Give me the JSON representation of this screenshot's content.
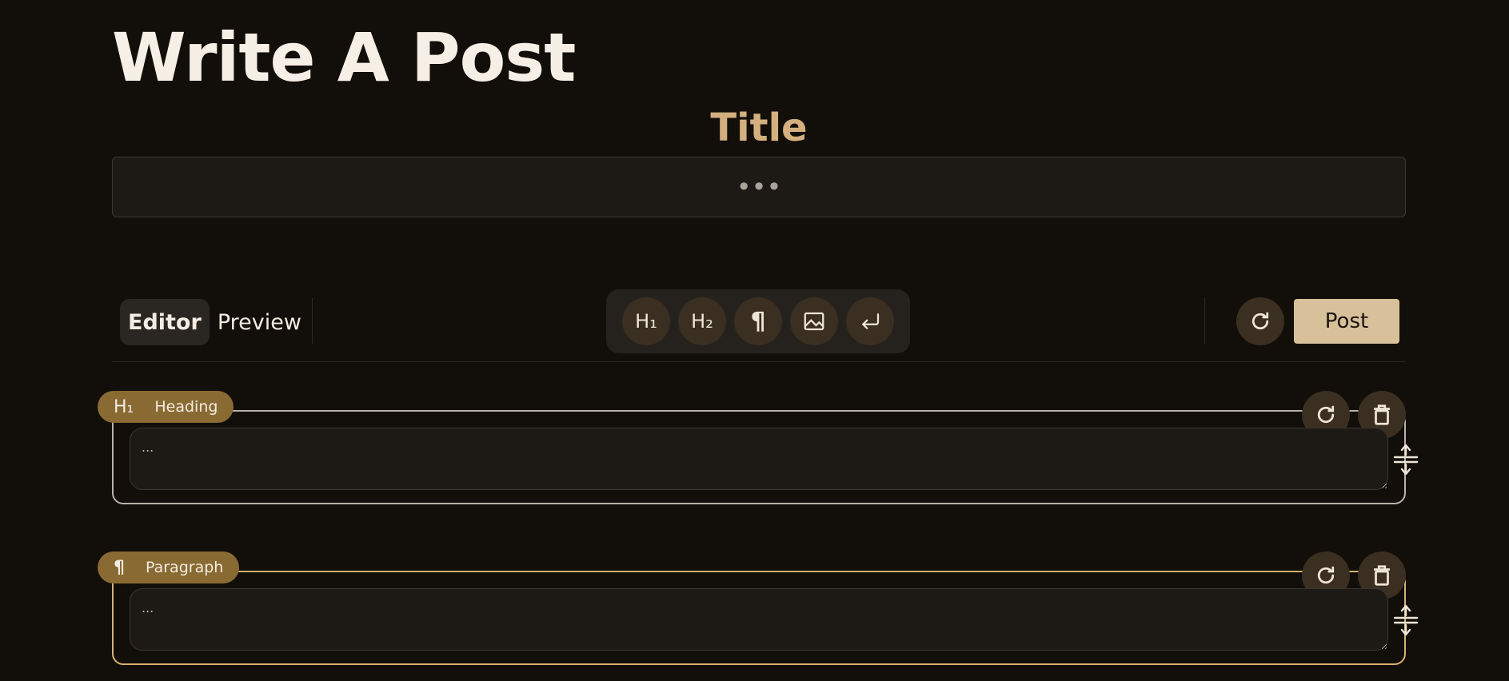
{
  "page": {
    "title": "Write A Post"
  },
  "title_field": {
    "label": "Title",
    "placeholder": "•••"
  },
  "mode_switch": {
    "editor": "Editor",
    "preview": "Preview"
  },
  "block_tools": [
    {
      "name": "h1",
      "label": "H₁"
    },
    {
      "name": "h2",
      "label": "H₂"
    },
    {
      "name": "paragraph",
      "label": "¶"
    },
    {
      "name": "image",
      "label": ""
    },
    {
      "name": "newline",
      "label": ""
    }
  ],
  "actions": {
    "post": "Post"
  },
  "blocks": [
    {
      "type": "heading",
      "icon_text": "H₁",
      "label": "Heading",
      "placeholder": "..."
    },
    {
      "type": "paragraph",
      "icon_text": "¶",
      "label": "Paragraph",
      "placeholder": "..."
    }
  ],
  "colors": {
    "background": "#120e09",
    "accent": "#d3b07e",
    "tag": "#8a6a33",
    "post_button": "#d8c19a",
    "paragraph_border": "#d6b26e",
    "heading_border": "#b9b2a8"
  }
}
